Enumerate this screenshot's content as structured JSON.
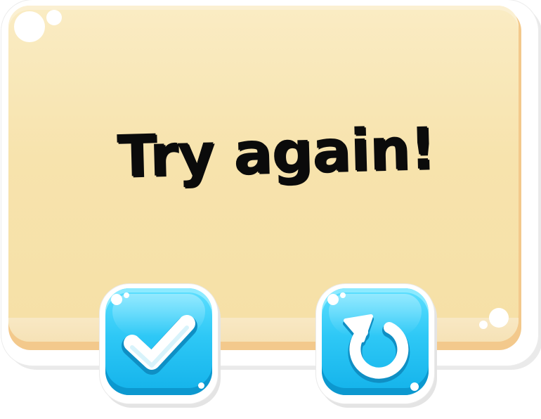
{
  "dialog": {
    "title": "Try again!"
  },
  "buttons": [
    {
      "id": "confirm",
      "icon": "checkmark-icon"
    },
    {
      "id": "retry",
      "icon": "restart-arrow-icon"
    }
  ],
  "colors": {
    "board": "#f7e3ad",
    "board_edge": "#f3c98c",
    "button": "#2ec8f6",
    "button_dark": "#0c98cf",
    "title_text": "#0b0b0b"
  }
}
